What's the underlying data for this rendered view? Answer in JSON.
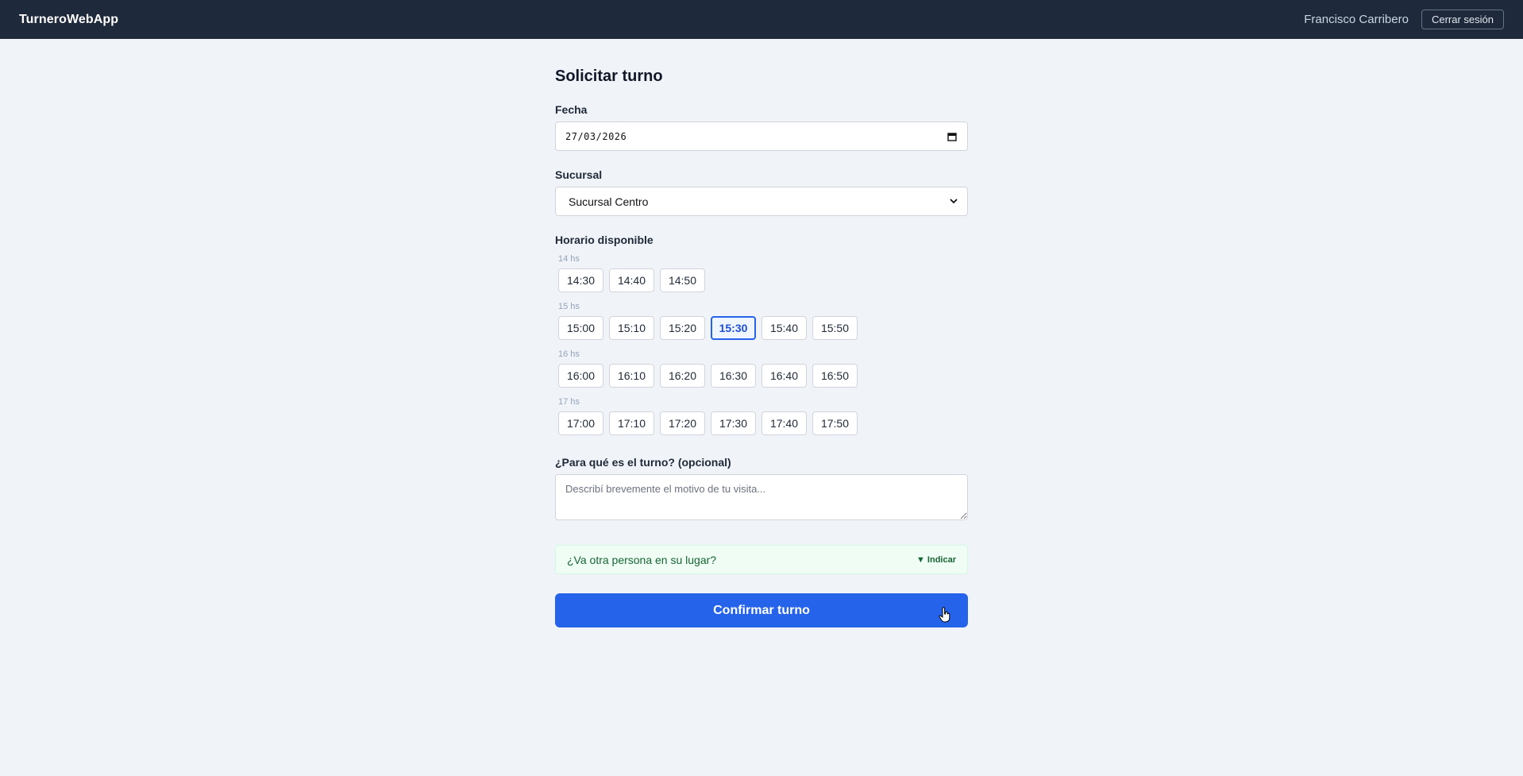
{
  "navbar": {
    "brand": "TurneroWebApp",
    "user_name": "Francisco Carribero",
    "logout_label": "Cerrar sesión"
  },
  "form": {
    "title": "Solicitar turno",
    "date": {
      "label": "Fecha",
      "value": "27/03/2026"
    },
    "branch": {
      "label": "Sucursal",
      "value": "Sucursal Centro"
    },
    "schedule": {
      "label": "Horario disponible",
      "selected": "15:30",
      "groups": [
        {
          "label": "14 hs",
          "slots": [
            "14:30",
            "14:40",
            "14:50"
          ]
        },
        {
          "label": "15 hs",
          "slots": [
            "15:00",
            "15:10",
            "15:20",
            "15:30",
            "15:40",
            "15:50"
          ]
        },
        {
          "label": "16 hs",
          "slots": [
            "16:00",
            "16:10",
            "16:20",
            "16:30",
            "16:40",
            "16:50"
          ]
        },
        {
          "label": "17 hs",
          "slots": [
            "17:00",
            "17:10",
            "17:20",
            "17:30",
            "17:40",
            "17:50"
          ]
        }
      ]
    },
    "reason": {
      "label": "¿Para qué es el turno? (opcional)",
      "placeholder": "Describí brevemente el motivo de tu visita..."
    },
    "other_person": {
      "text": "¿Va otra persona en su lugar?",
      "toggle_label": "Indicar"
    },
    "confirm_label": "Confirmar turno"
  },
  "colors": {
    "navbar_bg": "#1e293b",
    "page_bg": "#f0f4f9",
    "accent": "#2563eb",
    "success_bg": "#f0fdf4",
    "success_text": "#166534"
  }
}
